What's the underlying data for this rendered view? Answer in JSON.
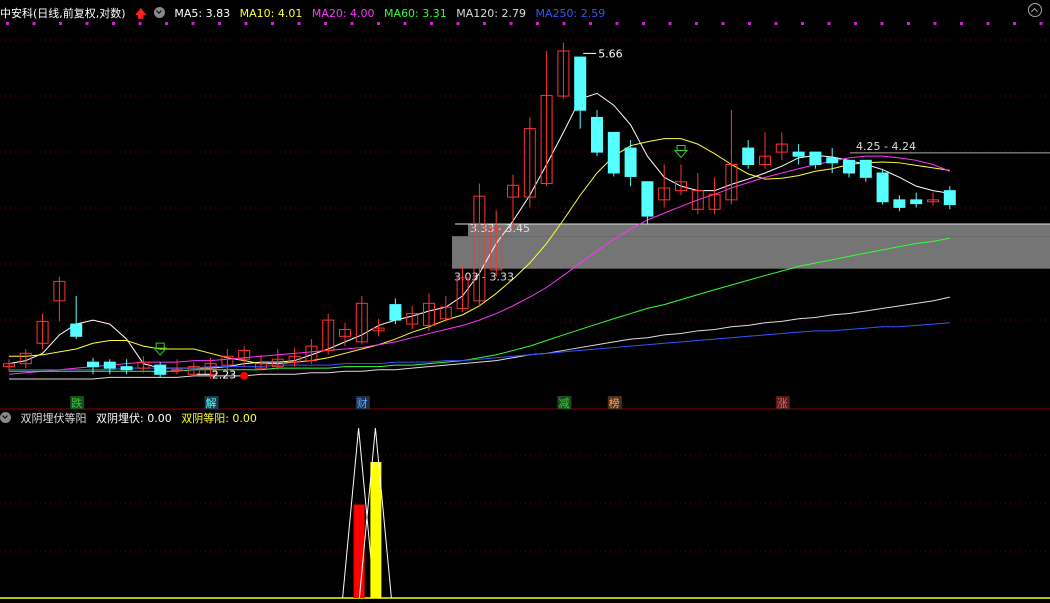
{
  "header": {
    "stock": "中安科(日线,前复权,对数)",
    "ma": [
      {
        "label": "MA5: 3.83",
        "color": "#ffffff"
      },
      {
        "label": "MA10: 4.01",
        "color": "#ffff33"
      },
      {
        "label": "MA20: 4.00",
        "color": "#ff33ff"
      },
      {
        "label": "MA60: 3.31",
        "color": "#33ff33"
      },
      {
        "label": "MA120: 2.79",
        "color": "#dddddd"
      },
      {
        "label": "MA250: 2.59",
        "color": "#3355ff"
      }
    ]
  },
  "sub_header": {
    "name": "双阴埋伏等阳",
    "items": [
      {
        "label": "双阴埋伏: 0.00",
        "color": "#ffffff"
      },
      {
        "label": "双阴等阳: 0.00",
        "color": "#ffff33"
      }
    ]
  },
  "colors": {
    "up": "#ff3333",
    "down": "#55ffff",
    "grid": "#7a0000",
    "divider": "#8b0000",
    "band": "#8a8a8a"
  },
  "chart_data": [
    {
      "type": "candlestick",
      "scale": "log",
      "ylim": [
        2.1,
        6.2
      ],
      "x": [
        1,
        2,
        3,
        4,
        5,
        6,
        7,
        8,
        9,
        10,
        11,
        12,
        13,
        14,
        15,
        16,
        17,
        18,
        19,
        20,
        21,
        22,
        23,
        24,
        25,
        26,
        27,
        28,
        29,
        30,
        31,
        32,
        33,
        34,
        35,
        36,
        37,
        38,
        39,
        40,
        41,
        42,
        43,
        44,
        45,
        46,
        47,
        48,
        49,
        50,
        51,
        52,
        53,
        54,
        55,
        56,
        57,
        58,
        59
      ],
      "open": [
        2.28,
        2.3,
        2.44,
        2.76,
        2.58,
        2.31,
        2.31,
        2.28,
        2.27,
        2.29,
        2.26,
        2.23,
        2.23,
        2.29,
        2.33,
        2.27,
        2.28,
        2.31,
        2.32,
        2.39,
        2.49,
        2.45,
        2.53,
        2.73,
        2.58,
        2.57,
        2.62,
        2.7,
        2.76,
        3.02,
        3.73,
        3.73,
        3.88,
        5.0,
        5.6,
        4.7,
        4.5,
        4.3,
        3.9,
        3.7,
        3.8,
        3.6,
        3.6,
        3.7,
        4.3,
        4.1,
        4.25,
        4.25,
        4.25,
        4.18,
        4.15,
        4.15,
        4.0,
        3.7,
        3.7,
        3.68,
        3.8
      ],
      "close": [
        2.3,
        2.37,
        2.6,
        2.92,
        2.49,
        2.28,
        2.27,
        2.26,
        2.31,
        2.23,
        2.26,
        2.28,
        2.3,
        2.35,
        2.39,
        2.3,
        2.33,
        2.35,
        2.42,
        2.61,
        2.54,
        2.74,
        2.55,
        2.61,
        2.66,
        2.74,
        2.71,
        2.95,
        3.74,
        3.41,
        3.86,
        4.55,
        5.01,
        5.7,
        4.8,
        4.25,
        4.0,
        3.96,
        3.53,
        3.83,
        3.9,
        3.8,
        3.76,
        4.1,
        4.1,
        4.2,
        4.35,
        4.2,
        4.1,
        4.12,
        4.0,
        3.95,
        3.68,
        3.62,
        3.66,
        3.7,
        3.65
      ],
      "high": [
        2.33,
        2.4,
        2.66,
        2.96,
        2.8,
        2.34,
        2.33,
        2.33,
        2.35,
        2.31,
        2.33,
        2.31,
        2.34,
        2.4,
        2.42,
        2.36,
        2.4,
        2.41,
        2.47,
        2.66,
        2.59,
        2.8,
        2.62,
        2.78,
        2.72,
        2.82,
        2.8,
        3.05,
        3.88,
        3.59,
        3.98,
        4.7,
        5.7,
        5.84,
        5.1,
        4.8,
        4.3,
        4.4,
        3.7,
        4.1,
        4.1,
        4.0,
        3.95,
        4.8,
        4.4,
        4.5,
        4.5,
        4.35,
        4.25,
        4.3,
        4.15,
        4.15,
        4.05,
        3.75,
        3.78,
        3.78,
        3.85
      ],
      "low": [
        2.25,
        2.27,
        2.4,
        2.6,
        2.47,
        2.23,
        2.23,
        2.23,
        2.24,
        2.21,
        2.23,
        2.22,
        2.2,
        2.25,
        2.28,
        2.26,
        2.26,
        2.28,
        2.3,
        2.36,
        2.42,
        2.43,
        2.49,
        2.58,
        2.54,
        2.53,
        2.6,
        2.67,
        2.72,
        2.96,
        3.4,
        3.62,
        3.85,
        4.96,
        4.55,
        4.2,
        3.96,
        3.85,
        3.45,
        3.62,
        3.75,
        3.55,
        3.55,
        3.65,
        4.05,
        4.05,
        4.15,
        4.1,
        4.05,
        4.0,
        3.95,
        3.9,
        3.65,
        3.58,
        3.62,
        3.64,
        3.6
      ],
      "series": [
        {
          "name": "MA5",
          "color": "#ffffff",
          "values": [
            2.3,
            2.32,
            2.37,
            2.5,
            2.58,
            2.61,
            2.58,
            2.47,
            2.3,
            2.27,
            2.27,
            2.27,
            2.27,
            2.28,
            2.3,
            2.31,
            2.31,
            2.32,
            2.36,
            2.4,
            2.45,
            2.5,
            2.57,
            2.61,
            2.64,
            2.68,
            2.71,
            2.8,
            2.99,
            3.26,
            3.48,
            3.75,
            4.1,
            4.5,
            4.96,
            5.04,
            4.87,
            4.6,
            4.2,
            3.95,
            3.85,
            3.8,
            3.8,
            3.87,
            3.93,
            4.0,
            4.08,
            4.18,
            4.21,
            4.19,
            4.15,
            4.1,
            4.04,
            3.95,
            3.85,
            3.8,
            3.77
          ]
        },
        {
          "name": "MA10",
          "color": "#ffff33",
          "values": [
            2.35,
            2.35,
            2.36,
            2.38,
            2.4,
            2.44,
            2.46,
            2.46,
            2.42,
            2.4,
            2.4,
            2.4,
            2.37,
            2.34,
            2.32,
            2.3,
            2.3,
            2.31,
            2.32,
            2.34,
            2.37,
            2.4,
            2.43,
            2.47,
            2.52,
            2.56,
            2.61,
            2.65,
            2.72,
            2.82,
            2.94,
            3.08,
            3.26,
            3.49,
            3.75,
            4.0,
            4.2,
            4.33,
            4.38,
            4.42,
            4.42,
            4.35,
            4.23,
            4.1,
            3.99,
            3.93,
            3.94,
            3.97,
            4.02,
            4.05,
            4.1,
            4.12,
            4.13,
            4.12,
            4.09,
            4.06,
            4.03
          ]
        },
        {
          "name": "MA20",
          "color": "#ff33ff",
          "values": [
            2.23,
            2.24,
            2.25,
            2.26,
            2.27,
            2.28,
            2.29,
            2.3,
            2.31,
            2.31,
            2.31,
            2.32,
            2.32,
            2.33,
            2.34,
            2.35,
            2.36,
            2.37,
            2.38,
            2.39,
            2.4,
            2.41,
            2.43,
            2.45,
            2.48,
            2.51,
            2.54,
            2.57,
            2.61,
            2.66,
            2.72,
            2.79,
            2.87,
            2.97,
            3.08,
            3.19,
            3.3,
            3.4,
            3.49,
            3.56,
            3.63,
            3.7,
            3.76,
            3.83,
            3.89,
            3.95,
            4.0,
            4.05,
            4.1,
            4.14,
            4.18,
            4.2,
            4.2,
            4.18,
            4.15,
            4.1,
            4.02
          ]
        },
        {
          "name": "MA60",
          "color": "#33ff33",
          "values": [
            2.25,
            2.25,
            2.25,
            2.25,
            2.25,
            2.25,
            2.25,
            2.25,
            2.25,
            2.25,
            2.25,
            2.26,
            2.26,
            2.26,
            2.26,
            2.26,
            2.27,
            2.27,
            2.27,
            2.27,
            2.28,
            2.28,
            2.28,
            2.29,
            2.29,
            2.3,
            2.31,
            2.32,
            2.34,
            2.36,
            2.39,
            2.42,
            2.46,
            2.5,
            2.54,
            2.58,
            2.62,
            2.66,
            2.7,
            2.73,
            2.77,
            2.81,
            2.85,
            2.89,
            2.93,
            2.97,
            3.01,
            3.05,
            3.08,
            3.11,
            3.14,
            3.17,
            3.2,
            3.23,
            3.26,
            3.28,
            3.31
          ]
        },
        {
          "name": "MA120",
          "color": "#dddddd",
          "values": [
            2.2,
            2.2,
            2.2,
            2.2,
            2.2,
            2.2,
            2.21,
            2.21,
            2.21,
            2.21,
            2.21,
            2.22,
            2.22,
            2.22,
            2.22,
            2.23,
            2.23,
            2.23,
            2.24,
            2.24,
            2.25,
            2.25,
            2.26,
            2.26,
            2.27,
            2.28,
            2.29,
            2.3,
            2.31,
            2.32,
            2.34,
            2.36,
            2.37,
            2.39,
            2.41,
            2.43,
            2.45,
            2.47,
            2.48,
            2.5,
            2.51,
            2.53,
            2.54,
            2.56,
            2.57,
            2.59,
            2.6,
            2.62,
            2.63,
            2.65,
            2.66,
            2.68,
            2.7,
            2.72,
            2.74,
            2.76,
            2.79
          ]
        },
        {
          "name": "MA250",
          "color": "#3355ff",
          "values": [
            2.26,
            2.26,
            2.26,
            2.26,
            2.26,
            2.26,
            2.26,
            2.27,
            2.27,
            2.27,
            2.27,
            2.27,
            2.28,
            2.28,
            2.28,
            2.28,
            2.29,
            2.29,
            2.29,
            2.29,
            2.3,
            2.3,
            2.3,
            2.31,
            2.31,
            2.31,
            2.32,
            2.32,
            2.33,
            2.34,
            2.35,
            2.36,
            2.37,
            2.38,
            2.39,
            2.4,
            2.41,
            2.42,
            2.43,
            2.44,
            2.45,
            2.46,
            2.47,
            2.48,
            2.49,
            2.5,
            2.51,
            2.52,
            2.53,
            2.53,
            2.54,
            2.55,
            2.56,
            2.56,
            2.57,
            2.58,
            2.59
          ]
        }
      ],
      "bands": [
        {
          "label": "3.03 - 3.33",
          "low": 3.03,
          "high": 3.33
        },
        {
          "label": "3.33 - 3.45",
          "low": 3.33,
          "high": 3.45
        }
      ],
      "resistance": {
        "label": "4.25 - 4.24",
        "value": 4.24
      },
      "annotations": [
        {
          "text": "5.66",
          "x": 35,
          "y": 5.66
        },
        {
          "text": "2.23",
          "x": 12,
          "y": 2.23
        }
      ],
      "signals": [
        {
          "text": "跌",
          "x": 5,
          "color": "#33cc33",
          "bg": "#1f4a1f"
        },
        {
          "text": "解",
          "x": 13,
          "color": "#55ffff",
          "bg": "#1f3a4a"
        },
        {
          "text": "财",
          "x": 22,
          "color": "#55aaff",
          "bg": "#1f2f4a"
        },
        {
          "text": "减",
          "x": 34,
          "color": "#33cc33",
          "bg": "#1f4a1f"
        },
        {
          "text": "榜",
          "x": 37,
          "color": "#ffaa55",
          "bg": "#4a2f1f"
        },
        {
          "text": "涨",
          "x": 47,
          "color": "#ff5555",
          "bg": "#4a1f1f"
        }
      ],
      "markers": [
        {
          "type": "arrow-down",
          "x": 10,
          "color": "#33cc33"
        },
        {
          "type": "arrow-down",
          "x": 41,
          "color": "#33cc33"
        },
        {
          "type": "dot",
          "x": 15,
          "color": "#ff0000"
        }
      ]
    },
    {
      "type": "bar",
      "title": "双阴埋伏等阳",
      "series": [
        {
          "name": "双阴埋伏",
          "color": "#ff0000",
          "values": [
            {
              "x": 23,
              "value": 0.55
            }
          ]
        },
        {
          "name": "双阴等阳",
          "color": "#ffff00",
          "values": [
            {
              "x": 24,
              "value": 0.8
            }
          ]
        }
      ],
      "ylim": [
        0,
        1
      ]
    }
  ]
}
